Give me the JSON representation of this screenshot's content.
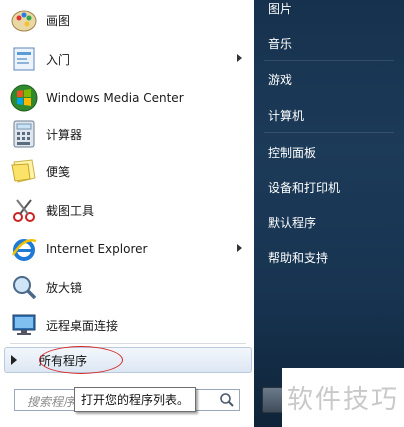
{
  "programs": [
    {
      "label": "画图",
      "icon": "paint-icon",
      "has_arrow": false
    },
    {
      "label": "入门",
      "icon": "getting-started-icon",
      "has_arrow": true
    },
    {
      "label": "Windows Media Center",
      "icon": "media-center-icon",
      "has_arrow": false
    },
    {
      "label": "计算器",
      "icon": "calculator-icon",
      "has_arrow": false
    },
    {
      "label": "便笺",
      "icon": "sticky-notes-icon",
      "has_arrow": false
    },
    {
      "label": "截图工具",
      "icon": "snipping-tool-icon",
      "has_arrow": false
    },
    {
      "label": "Internet Explorer",
      "icon": "internet-explorer-icon",
      "has_arrow": true
    },
    {
      "label": "放大镜",
      "icon": "magnifier-icon",
      "has_arrow": false
    },
    {
      "label": "远程桌面连接",
      "icon": "remote-desktop-icon",
      "has_arrow": false
    }
  ],
  "all_programs": {
    "label": "所有程序"
  },
  "search": {
    "placeholder": "搜索程序",
    "tooltip": "打开您的程序列表。"
  },
  "right_items": [
    "图片",
    "音乐",
    "游戏",
    "计算机",
    "控制面板",
    "设备和打印机",
    "默认程序",
    "帮助和支持"
  ],
  "watermark": {
    "text": "软件技巧"
  },
  "colors": {
    "right_panel": "#1c3b59",
    "highlight_oval": "#d42a2a"
  }
}
